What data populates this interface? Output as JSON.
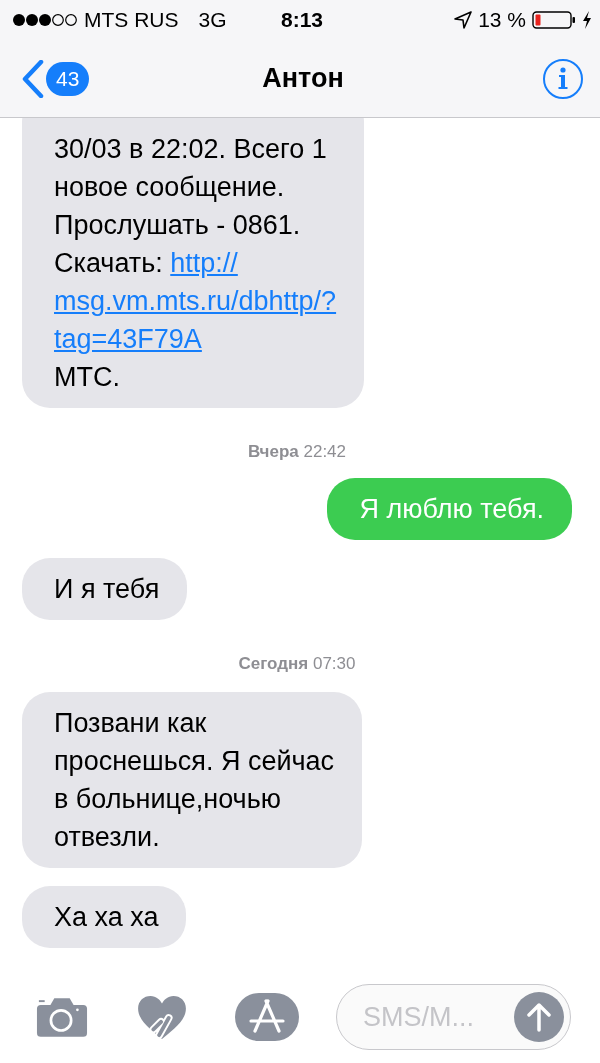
{
  "status_bar": {
    "carrier": "MTS RUS",
    "network": "3G",
    "time": "8:13",
    "battery": "13 %"
  },
  "nav": {
    "back_count": "43",
    "title": "Антон"
  },
  "messages": [
    {
      "kind": "received",
      "lines": [
        "30/03 в 22:02. Всего 1",
        "новое сообщение.",
        "Прослушать - 0861.",
        [
          {
            "text": "Скачать: "
          },
          {
            "text": "http://",
            "link": true
          }
        ],
        [
          {
            "text": "msg.vm.mts.ru/dbhttp/?",
            "link": true
          }
        ],
        [
          {
            "text": "tag=43F79A",
            "link": true
          }
        ],
        "МТС."
      ]
    },
    {
      "kind": "timestamp",
      "text": "**Вчера** 22:42"
    },
    {
      "kind": "sent",
      "lines": [
        "Я люблю тебя."
      ]
    },
    {
      "kind": "received",
      "lines": [
        "И я тебя"
      ]
    },
    {
      "kind": "timestamp",
      "text": "**Сегодня** 07:30"
    },
    {
      "kind": "received",
      "lines": [
        "Позвани как",
        "проснешься. Я сейчас",
        "в больнице,ночью",
        "отвезли."
      ]
    },
    {
      "kind": "received",
      "lines": [
        "Ха ха ха"
      ]
    }
  ],
  "composer": {
    "placeholder": "SMS/M..."
  }
}
